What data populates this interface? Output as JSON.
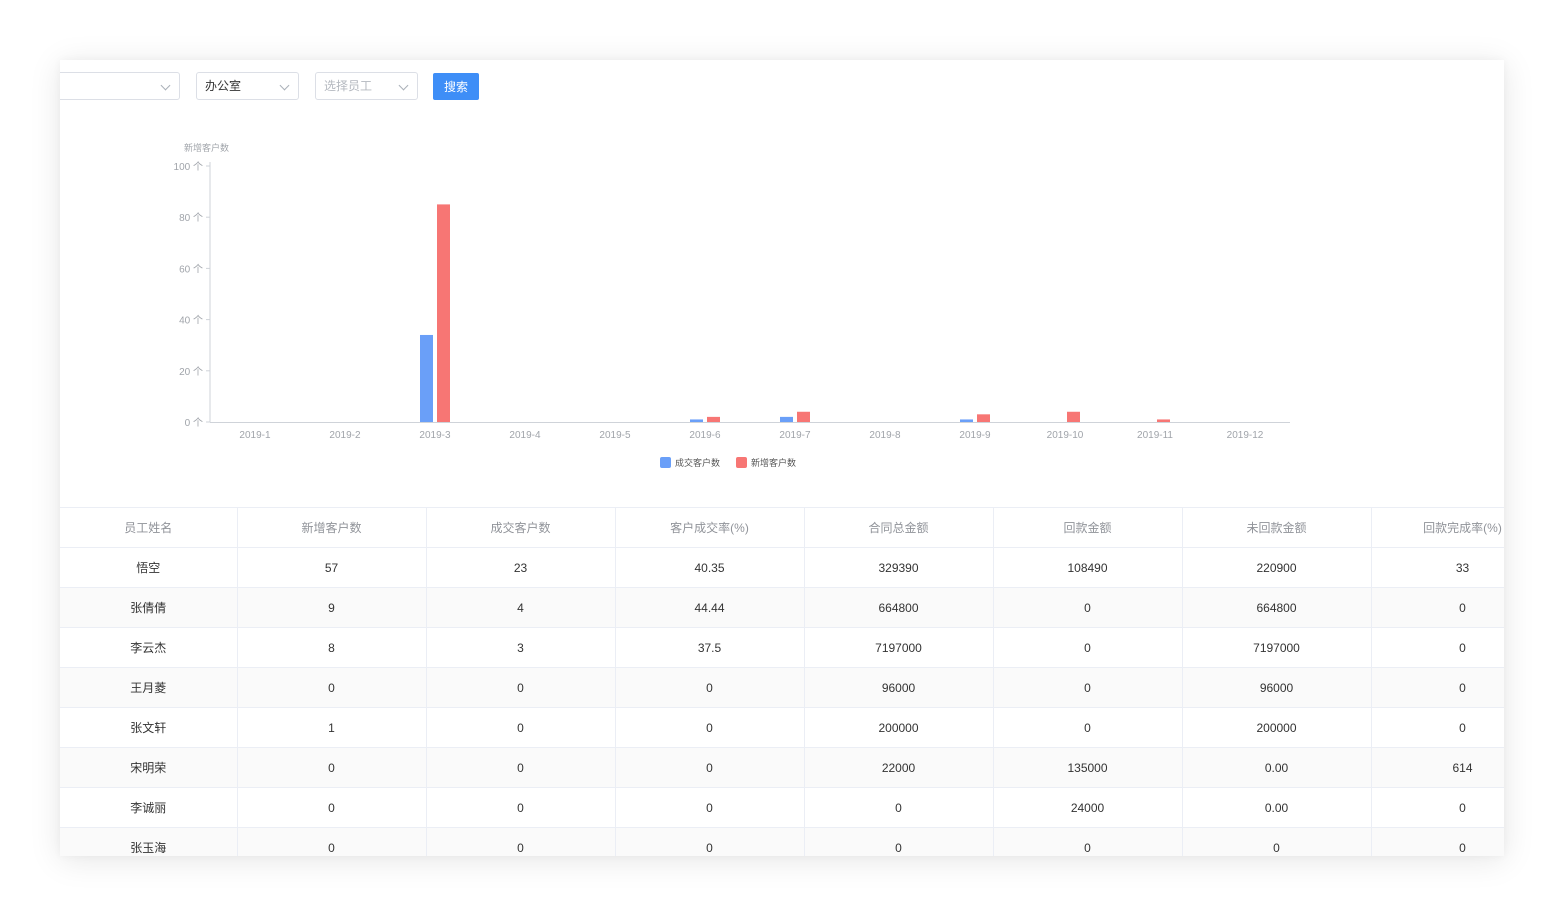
{
  "filters": {
    "first_select_value": "",
    "dept_select_value": "办公室",
    "employee_select_placeholder": "选择员工",
    "search_label": "搜索"
  },
  "chart_data": {
    "type": "bar",
    "ylabel": "新增客户数",
    "ylim": [
      0,
      100
    ],
    "yticks": [
      "0 个",
      "20 个",
      "40 个",
      "60 个",
      "80 个",
      "100 个"
    ],
    "categories": [
      "2019-1",
      "2019-2",
      "2019-3",
      "2019-4",
      "2019-5",
      "2019-6",
      "2019-7",
      "2019-8",
      "2019-9",
      "2019-10",
      "2019-11",
      "2019-12"
    ],
    "series": [
      {
        "name": "成交客户数",
        "color": "#6a9ff8",
        "values": [
          0,
          0,
          34,
          0,
          0,
          1,
          2,
          0,
          1,
          0,
          0,
          0
        ]
      },
      {
        "name": "新增客户数",
        "color": "#f77674",
        "values": [
          0,
          0,
          85,
          0,
          0,
          2,
          4,
          0,
          3,
          4,
          1,
          0
        ]
      }
    ],
    "legend_position": "bottom-center",
    "grid": false
  },
  "table": {
    "headers": [
      "员工姓名",
      "新增客户数",
      "成交客户数",
      "客户成交率(%)",
      "合同总金额",
      "回款金额",
      "未回款金额",
      "回款完成率(%)"
    ],
    "rows": [
      [
        "悟空",
        "57",
        "23",
        "40.35",
        "329390",
        "108490",
        "220900",
        "33"
      ],
      [
        "张倩倩",
        "9",
        "4",
        "44.44",
        "664800",
        "0",
        "664800",
        "0"
      ],
      [
        "李云杰",
        "8",
        "3",
        "37.5",
        "7197000",
        "0",
        "7197000",
        "0"
      ],
      [
        "王月菱",
        "0",
        "0",
        "0",
        "96000",
        "0",
        "96000",
        "0"
      ],
      [
        "张文轩",
        "1",
        "0",
        "0",
        "200000",
        "0",
        "200000",
        "0"
      ],
      [
        "宋明荣",
        "0",
        "0",
        "0",
        "22000",
        "135000",
        "0.00",
        "614"
      ],
      [
        "李诚丽",
        "0",
        "0",
        "0",
        "0",
        "24000",
        "0.00",
        "0"
      ],
      [
        "张玉海",
        "0",
        "0",
        "0",
        "0",
        "0",
        "0",
        "0"
      ]
    ]
  }
}
